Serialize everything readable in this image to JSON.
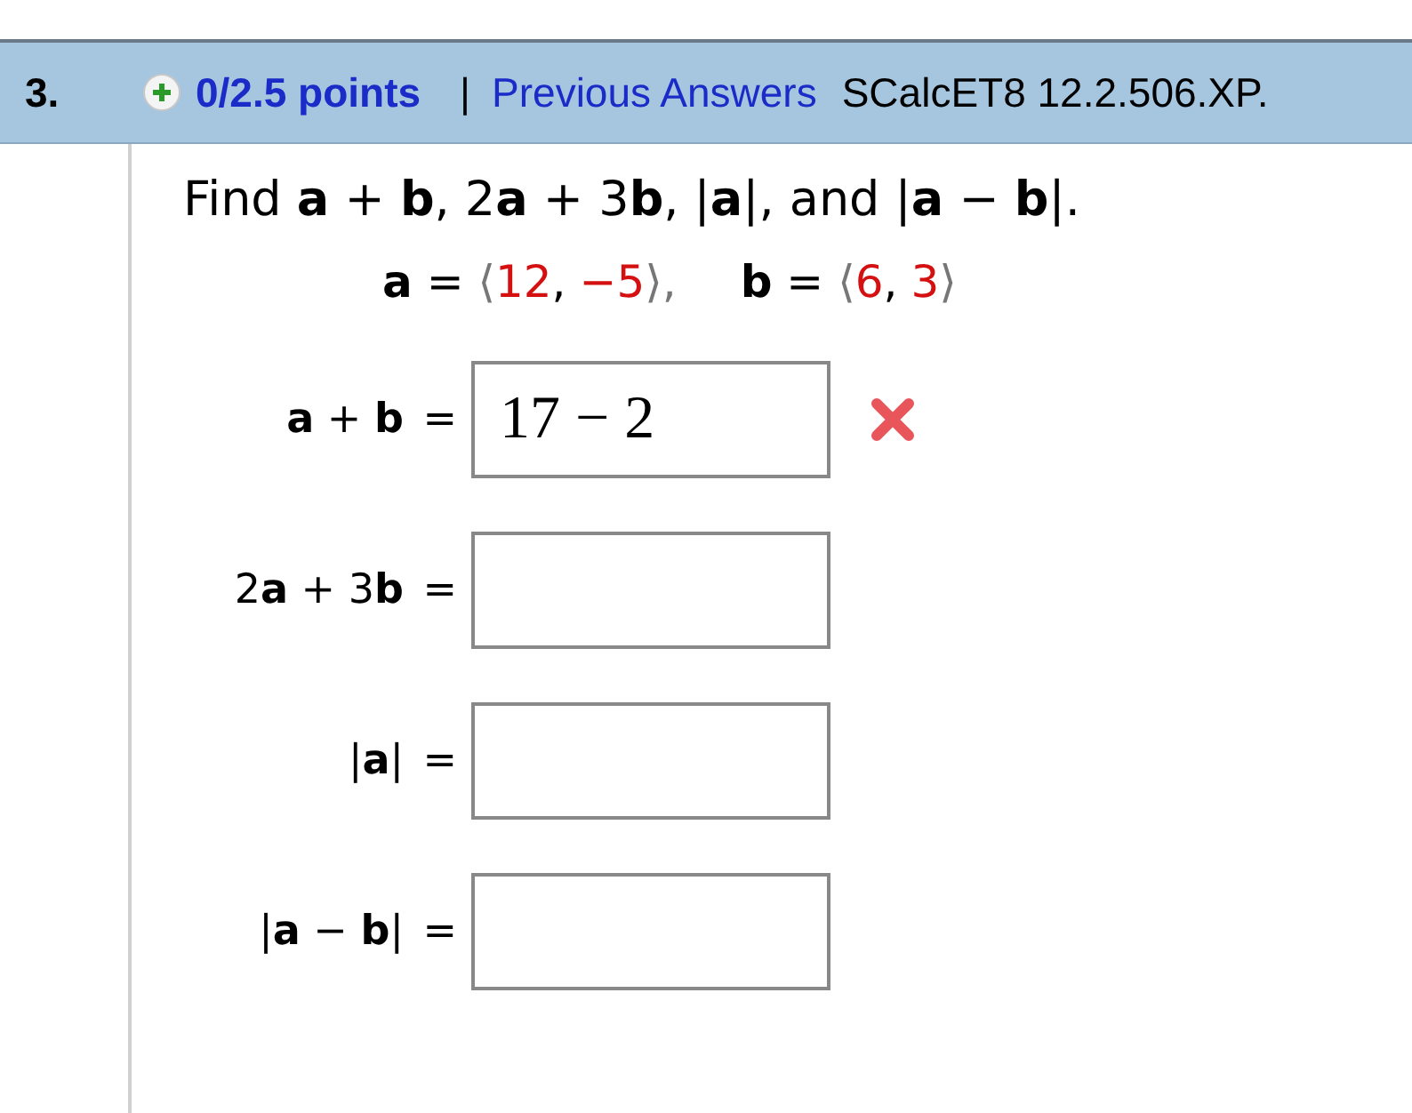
{
  "header": {
    "number": "3.",
    "points": "0/2.5 points",
    "separator": "|",
    "previous_answers": "Previous Answers",
    "source": "SCalcET8 12.2.506.XP."
  },
  "question": "Find  **a** + **b**, 2**a** + 3**b**, |**a**|, and |**a** − **b**|.",
  "vectors": [
    {
      "label": "a",
      "equals": "=",
      "open": "⟨",
      "components": [
        "12",
        "−5"
      ],
      "separator": ",",
      "close": "⟩,"
    },
    {
      "label": "b",
      "equals": "=",
      "open": "⟨",
      "components": [
        "6",
        "3"
      ],
      "separator": ",",
      "close": "⟩"
    }
  ],
  "answers": [
    {
      "label": "**a** + **b**",
      "equals": "=",
      "value": "17 − 2",
      "incorrect": true
    },
    {
      "label": "2**a** + 3**b**",
      "equals": "=",
      "incorrect": false
    },
    {
      "label": "|**a**|",
      "equals": "=",
      "incorrect": false
    },
    {
      "label": "|**a** − **b**|",
      "equals": "=",
      "incorrect": false
    }
  ]
}
